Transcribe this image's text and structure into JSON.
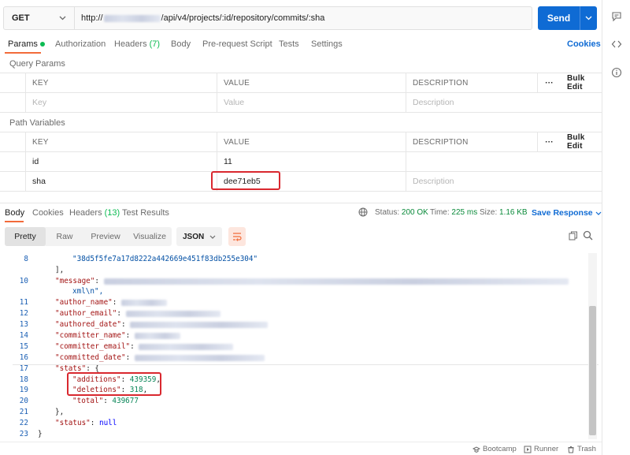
{
  "request": {
    "method": "GET",
    "url_prefix": "http://",
    "url_path": "/api/v4/projects/:id/repository/commits/:sha",
    "send_label": "Send"
  },
  "req_tabs": {
    "params": "Params",
    "authorization": "Authorization",
    "headers": "Headers",
    "headers_count": "(7)",
    "body": "Body",
    "prerequest": "Pre-request Script",
    "tests": "Tests",
    "settings": "Settings",
    "cookies": "Cookies"
  },
  "query_params": {
    "title": "Query Params",
    "col_key": "KEY",
    "col_value": "VALUE",
    "col_desc": "DESCRIPTION",
    "more": "···",
    "bulk_edit": "Bulk Edit",
    "ph_key": "Key",
    "ph_value": "Value",
    "ph_desc": "Description"
  },
  "path_vars": {
    "title": "Path Variables",
    "col_key": "KEY",
    "col_value": "VALUE",
    "col_desc": "DESCRIPTION",
    "more": "···",
    "bulk_edit": "Bulk Edit",
    "rows": [
      {
        "key": "id",
        "value": "11",
        "desc": ""
      },
      {
        "key": "sha",
        "value": "dee71eb5",
        "desc": "Description"
      }
    ]
  },
  "response": {
    "tabs": {
      "body": "Body",
      "cookies": "Cookies",
      "headers": "Headers",
      "headers_count": "(13)",
      "test_results": "Test Results"
    },
    "status_label": "Status:",
    "status_value": "200 OK",
    "time_label": "Time:",
    "time_value": "225 ms",
    "size_label": "Size:",
    "size_value": "1.16 KB",
    "save_response": "Save Response"
  },
  "viewer": {
    "pretty": "Pretty",
    "raw": "Raw",
    "preview": "Preview",
    "visualize": "Visualize",
    "format": "JSON"
  },
  "code": {
    "l8_hash": "\"38d5f5fe7a17d8222a442669e451f83db255e304\"",
    "l9": "],",
    "l10_key": "\"message\"",
    "l10b": "xml\\n\",",
    "l11_key": "\"author_name\"",
    "l12_key": "\"author_email\"",
    "l13_key": "\"authored_date\"",
    "l14_key": "\"committer_name\"",
    "l15_key": "\"committer_email\"",
    "l16_key": "\"committed_date\"",
    "l17_key": "\"stats\"",
    "l18_key": "\"additions\"",
    "l18_val": "439359",
    "l19_key": "\"deletions\"",
    "l19_val": "318",
    "l20_key": "\"total\"",
    "l20_val": "439677",
    "l21": "},",
    "l22_key": "\"status\"",
    "l22_val": "null",
    "l23": "}"
  },
  "footer": {
    "bootcamp": "Bootcamp",
    "runner": "Runner",
    "trash": "Trash"
  },
  "colors": {
    "accent": "#f26b3a",
    "send": "#0f6bd4",
    "success": "#0cbb52",
    "highlight": "#d9282f"
  }
}
